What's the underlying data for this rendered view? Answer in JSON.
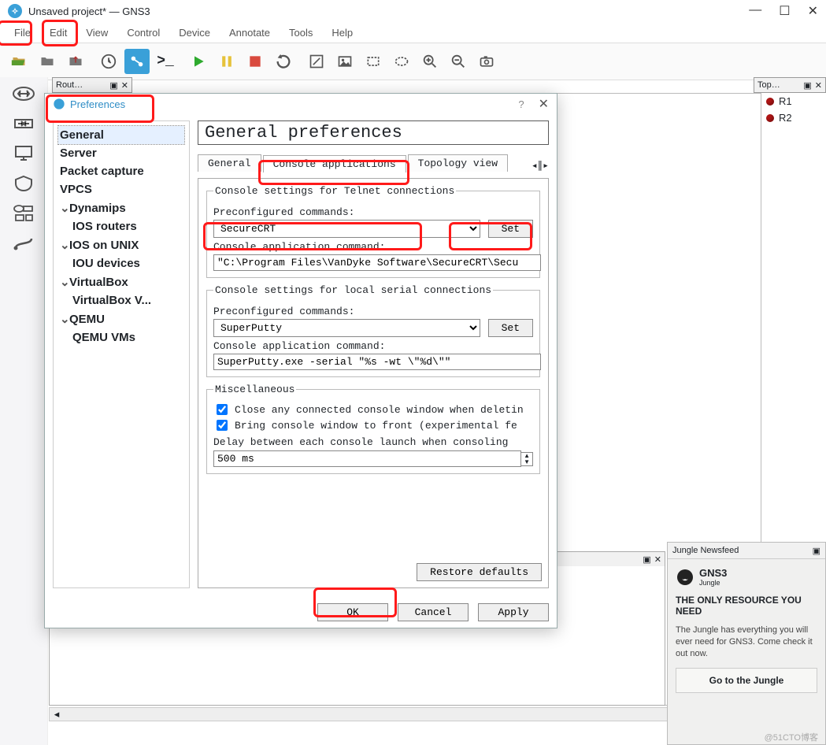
{
  "window": {
    "title": "Unsaved project* — GNS3"
  },
  "menu": {
    "file": "File",
    "edit": "Edit",
    "view": "View",
    "control": "Control",
    "device": "Device",
    "annotate": "Annotate",
    "tools": "Tools",
    "help": "Help"
  },
  "docks": {
    "routers": "Rout…",
    "topology": "Top…"
  },
  "topo": {
    "r1": "R1",
    "r2": "R2"
  },
  "jungle": {
    "title": "Jungle Newsfeed",
    "brand": "GNS3",
    "brand_sub": "Jungle",
    "headline": "THE ONLY RESOURCE YOU NEED",
    "body": "The Jungle has everything you will ever need for GNS3. Come check it out now.",
    "cta": "Go to the Jungle"
  },
  "prefs": {
    "title": "Preferences",
    "tree": {
      "general": "General",
      "server": "Server",
      "packet": "Packet capture",
      "vpcs": "VPCS",
      "dynamips": "Dynamips",
      "ios": "IOS routers",
      "iosunix": "IOS on UNIX",
      "iou": "IOU devices",
      "vbox": "VirtualBox",
      "vboxvm": "VirtualBox V...",
      "qemu": "QEMU",
      "qemuvms": "QEMU VMs"
    },
    "heading": "General preferences",
    "tabs": {
      "general": "General",
      "console": "Console applications",
      "topo": "Topology view"
    },
    "telnet": {
      "legend": "Console settings for Telnet connections",
      "pre_label": "Preconfigured commands:",
      "pre_value": "SecureCRT",
      "set": "Set",
      "cmd_label": "Console application command:",
      "cmd_value": "\"C:\\Program Files\\VanDyke Software\\SecureCRT\\Secu"
    },
    "serial": {
      "legend": "Console settings for local serial connections",
      "pre_label": "Preconfigured commands:",
      "pre_value": "SuperPutty",
      "set": "Set",
      "cmd_label": "Console application command:",
      "cmd_value": "SuperPutty.exe -serial \"%s -wt \\\"%d\\\"\""
    },
    "misc": {
      "legend": "Miscellaneous",
      "close": "Close any connected console window when deletin",
      "front": "Bring console window to front (experimental fe",
      "delay_label": "Delay between each console launch when consoling",
      "delay_value": "500 ms"
    },
    "buttons": {
      "restore": "Restore defaults",
      "ok": "OK",
      "cancel": "Cancel",
      "apply": "Apply"
    }
  },
  "watermark": "@51CTO博客"
}
